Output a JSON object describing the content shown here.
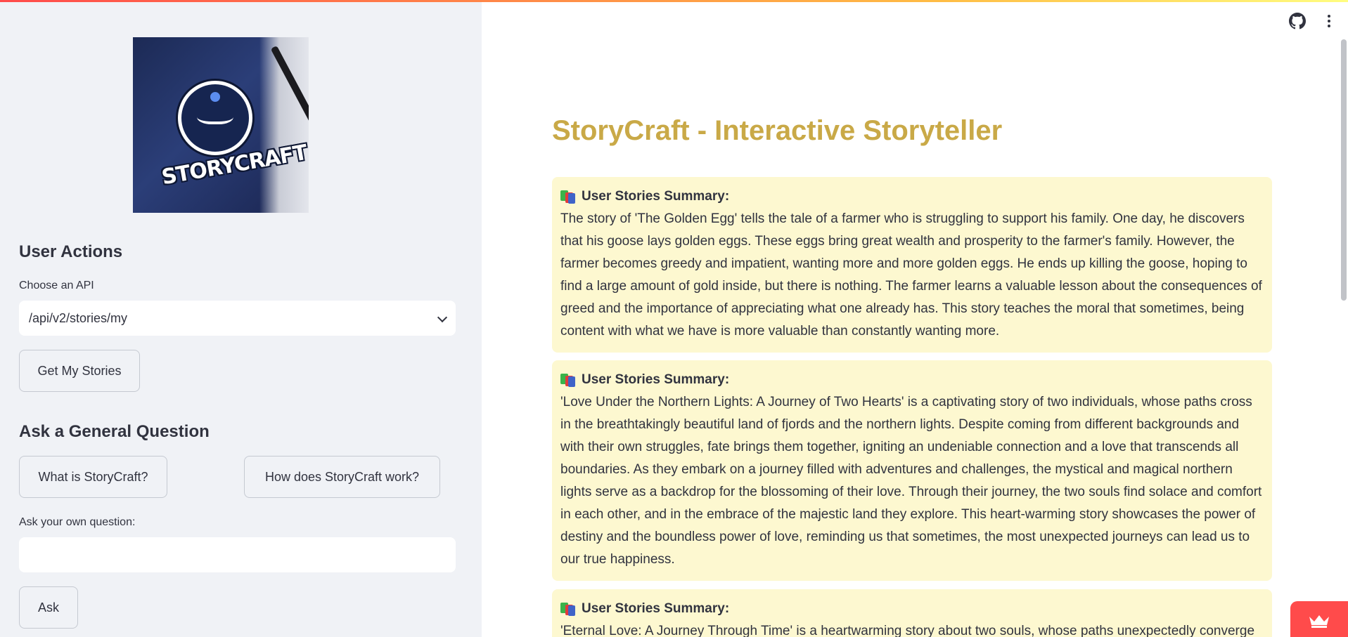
{
  "sidebar": {
    "logo_text": "STORYCRAFT",
    "user_actions_heading": "User Actions",
    "api_select_label": "Choose an API",
    "api_select_value": "/api/v2/stories/my",
    "get_stories_button": "Get My Stories",
    "general_question_heading": "Ask a General Question",
    "question_buttons": [
      "What is StoryCraft?",
      "How does StoryCraft work?"
    ],
    "own_question_label": "Ask your own question:",
    "own_question_value": "",
    "ask_button": "Ask"
  },
  "toolbar": {
    "github_icon": "github-icon",
    "menu_icon": "kebab-menu-icon"
  },
  "main": {
    "title": "StoryCraft - Interactive Storyteller",
    "cards": [
      {
        "title": "User Stories Summary:",
        "body": "The story of 'The Golden Egg' tells the tale of a farmer who is struggling to support his family. One day, he discovers that his goose lays golden eggs. These eggs bring great wealth and prosperity to the farmer's family. However, the farmer becomes greedy and impatient, wanting more and more golden eggs. He ends up killing the goose, hoping to find a large amount of gold inside, but there is nothing. The farmer learns a valuable lesson about the consequences of greed and the importance of appreciating what one already has. This story teaches the moral that sometimes, being content with what we have is more valuable than constantly wanting more."
      },
      {
        "title": "User Stories Summary:",
        "body": "'Love Under the Northern Lights: A Journey of Two Hearts' is a captivating story of two individuals, whose paths cross in the breathtakingly beautiful land of fjords and the northern lights. Despite coming from different backgrounds and with their own struggles, fate brings them together, igniting an undeniable connection and a love that transcends all boundaries. As they embark on a journey filled with adventures and challenges, the mystical and magical northern lights serve as a backdrop for the blossoming of their love. Through their journey, the two souls find solace and comfort in each other, and in the embrace of the majestic land they explore. This heart-warming story showcases the power of destiny and the boundless power of love, reminding us that sometimes, the most unexpected journeys can lead us to our true happiness."
      },
      {
        "title": "User Stories Summary:",
        "body": "'Eternal Love: A Journey Through Time' is a heartwarming story about two souls, whose paths unexpectedly converge in"
      }
    ]
  },
  "colors": {
    "sidebar_bg": "#f0f2f6",
    "title_color": "#c9a947",
    "card_bg": "#fdf8d0",
    "accent": "#ff4b4b"
  }
}
